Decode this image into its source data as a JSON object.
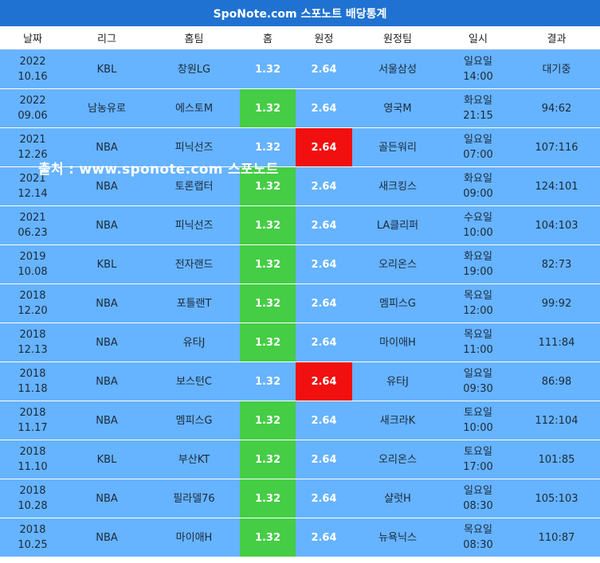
{
  "title": "SpoNote.com 스포노트 배당통계",
  "columns": [
    "날짜",
    "리그",
    "홈팀",
    "홈",
    "원정",
    "원정팀",
    "일시",
    "결과"
  ],
  "watermark": "출처 : www.sponote.com 스포노트",
  "colors": {
    "header": "#1f72d1",
    "row": "#66b3ff",
    "win_green": "#45cd45",
    "win_red": "#f20f0f"
  },
  "rows": [
    {
      "year": "2022",
      "md": "10.16",
      "league": "KBL",
      "home": "창원LG",
      "home_odds": "1.32",
      "away_odds": "2.64",
      "away": "서울삼성",
      "day": "일요일",
      "time": "14:00",
      "result": "대기중",
      "winner": "none"
    },
    {
      "year": "2022",
      "md": "09.06",
      "league": "남농유로",
      "home": "에스토M",
      "home_odds": "1.32",
      "away_odds": "2.64",
      "away": "영국M",
      "day": "화요일",
      "time": "21:15",
      "result": "94:62",
      "winner": "home"
    },
    {
      "year": "2021",
      "md": "12.26",
      "league": "NBA",
      "home": "피닉선즈",
      "home_odds": "1.32",
      "away_odds": "2.64",
      "away": "골든워리",
      "day": "일요일",
      "time": "07:00",
      "result": "107:116",
      "winner": "away"
    },
    {
      "year": "2021",
      "md": "12.14",
      "league": "NBA",
      "home": "토론랩터",
      "home_odds": "1.32",
      "away_odds": "2.64",
      "away": "새크킹스",
      "day": "화요일",
      "time": "09:00",
      "result": "124:101",
      "winner": "home"
    },
    {
      "year": "2021",
      "md": "06.23",
      "league": "NBA",
      "home": "피닉선즈",
      "home_odds": "1.32",
      "away_odds": "2.64",
      "away": "LA클리퍼",
      "day": "수요일",
      "time": "10:00",
      "result": "104:103",
      "winner": "home"
    },
    {
      "year": "2019",
      "md": "10.08",
      "league": "KBL",
      "home": "전자랜드",
      "home_odds": "1.32",
      "away_odds": "2.64",
      "away": "오리온스",
      "day": "화요일",
      "time": "19:00",
      "result": "82:73",
      "winner": "home"
    },
    {
      "year": "2018",
      "md": "12.20",
      "league": "NBA",
      "home": "포틀랜T",
      "home_odds": "1.32",
      "away_odds": "2.64",
      "away": "멤피스G",
      "day": "목요일",
      "time": "12:00",
      "result": "99:92",
      "winner": "home"
    },
    {
      "year": "2018",
      "md": "12.13",
      "league": "NBA",
      "home": "유타J",
      "home_odds": "1.32",
      "away_odds": "2.64",
      "away": "마이애H",
      "day": "목요일",
      "time": "11:00",
      "result": "111:84",
      "winner": "home"
    },
    {
      "year": "2018",
      "md": "11.18",
      "league": "NBA",
      "home": "보스턴C",
      "home_odds": "1.32",
      "away_odds": "2.64",
      "away": "유타J",
      "day": "일요일",
      "time": "09:30",
      "result": "86:98",
      "winner": "away"
    },
    {
      "year": "2018",
      "md": "11.17",
      "league": "NBA",
      "home": "멤피스G",
      "home_odds": "1.32",
      "away_odds": "2.64",
      "away": "새크라K",
      "day": "토요일",
      "time": "10:00",
      "result": "112:104",
      "winner": "home"
    },
    {
      "year": "2018",
      "md": "11.10",
      "league": "KBL",
      "home": "부산KT",
      "home_odds": "1.32",
      "away_odds": "2.64",
      "away": "오리온스",
      "day": "토요일",
      "time": "17:00",
      "result": "101:85",
      "winner": "home"
    },
    {
      "year": "2018",
      "md": "10.28",
      "league": "NBA",
      "home": "필라델76",
      "home_odds": "1.32",
      "away_odds": "2.64",
      "away": "샬럿H",
      "day": "일요일",
      "time": "08:30",
      "result": "105:103",
      "winner": "home"
    },
    {
      "year": "2018",
      "md": "10.25",
      "league": "NBA",
      "home": "마이애H",
      "home_odds": "1.32",
      "away_odds": "2.64",
      "away": "뉴욕닉스",
      "day": "목요일",
      "time": "08:30",
      "result": "110:87",
      "winner": "home"
    }
  ]
}
